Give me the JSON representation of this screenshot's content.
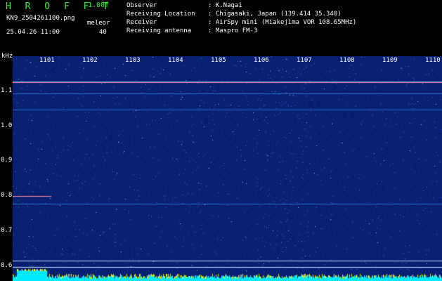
{
  "header": {
    "logo": "H R O F F T",
    "version": "1.00f",
    "filename": "KN9_2504261100.png",
    "meleor_label": "meleor",
    "datetime": "25.04.26 11:00",
    "meleor_value": "40",
    "info": [
      {
        "key": "Observer",
        "value": ": K.Nagai"
      },
      {
        "key": "Receiving Location",
        "value": ": Chigasaki, Japan (139.414 35.340)"
      },
      {
        "key": "Receiver",
        "value": ": AirSpy mini (Miakejima VOR 108.65MHz)"
      },
      {
        "key": "Receiving antenna",
        "value": ": Maspro FM-3"
      }
    ]
  },
  "plot": {
    "y_unit": "kHz",
    "y_ticks": [
      "1.1",
      "1.0",
      "0.9",
      "0.8",
      "0.7",
      "0.6"
    ],
    "x_ticks": [
      "1101",
      "1102",
      "1103",
      "1104",
      "1105",
      "1106",
      "1107",
      "1108",
      "1109",
      "1110"
    ],
    "colors": {
      "background": "#082072",
      "noise": "#3a6cd8",
      "hot": "#78e6f0",
      "carrier": "#ff8a8a",
      "floor": "#00eaff"
    }
  }
}
